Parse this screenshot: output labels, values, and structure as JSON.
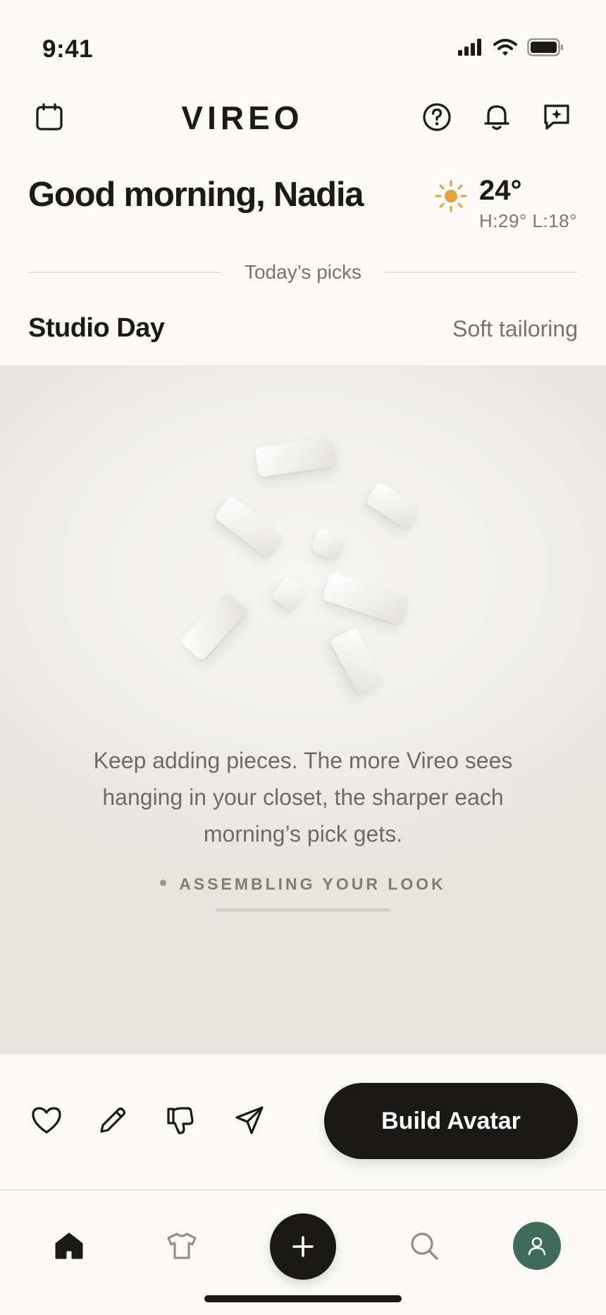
{
  "status_bar": {
    "time": "9:41"
  },
  "header": {
    "logo": "VIREO"
  },
  "greeting": "Good morning, Nadia",
  "weather": {
    "icon": "sun-icon",
    "temp": "24°",
    "hilo": "H:29° L:18°",
    "sun_color": "#e0a43a"
  },
  "section": {
    "label": "Today’s picks"
  },
  "outfit": {
    "title": "Studio Day",
    "style": "Soft tailoring"
  },
  "stage": {
    "message": "Keep adding pieces. The more Vireo sees hanging in your closet, the sharper each morning’s pick gets.",
    "status": "ASSEMBLING YOUR LOOK",
    "progress": 0.0
  },
  "actions": {
    "icons": [
      "heart-icon",
      "pencil-icon",
      "thumbs-down-icon",
      "send-icon"
    ],
    "build_button": "Build Avatar"
  },
  "nav": {
    "items": [
      "home-icon",
      "shirt-icon",
      "plus-icon",
      "search-icon",
      "profile-icon"
    ],
    "avatar_color": "#3f6b5b",
    "dark_color": "#1a1915"
  }
}
